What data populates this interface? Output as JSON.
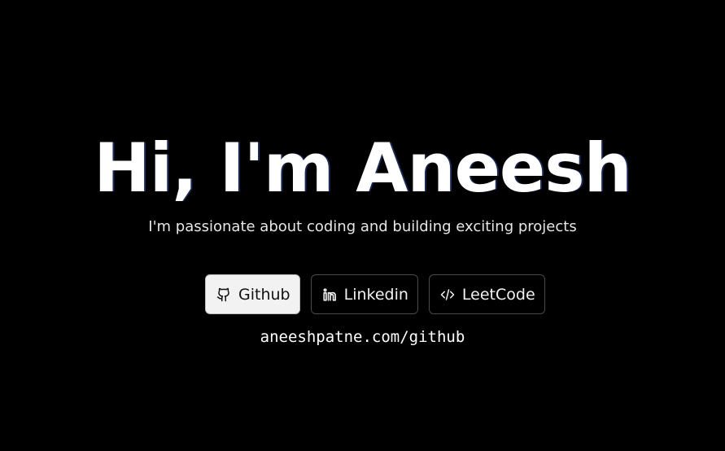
{
  "hero": {
    "title": "Hi, I'm Aneesh",
    "subtitle": "I'm passionate about coding and building exciting projects",
    "buttons": [
      {
        "label": "Github",
        "icon": "github-icon",
        "active": true
      },
      {
        "label": "Linkedin",
        "icon": "linkedin-icon",
        "active": false
      },
      {
        "label": "LeetCode",
        "icon": "code-icon",
        "active": false
      }
    ],
    "url": "aneeshpatne.com/github"
  },
  "colors": {
    "background": "#000000",
    "text": "#ffffff",
    "active_button_bg": "#f2f2f2",
    "button_border": "#4a4a4a"
  }
}
